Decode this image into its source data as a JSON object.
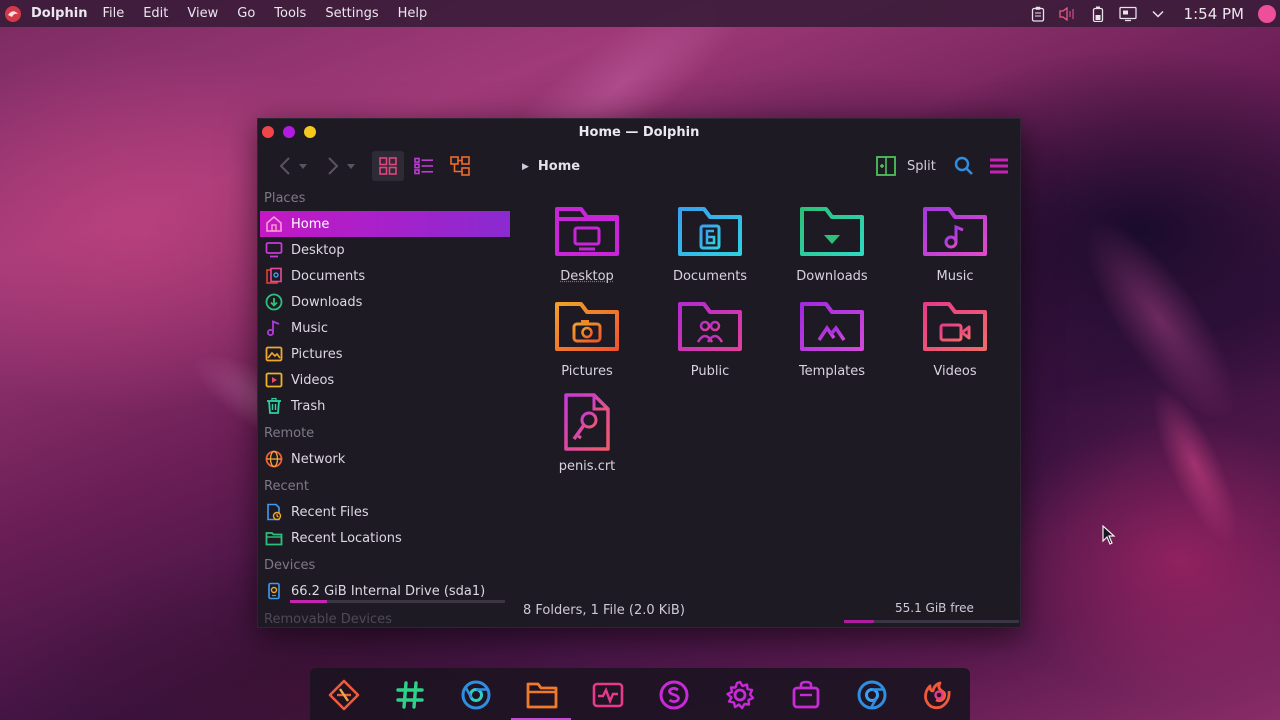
{
  "topbar": {
    "app_name": "Dolphin",
    "menus": [
      "File",
      "Edit",
      "View",
      "Go",
      "Tools",
      "Settings",
      "Help"
    ],
    "clock": "1:54 PM",
    "tray_icons": [
      "clipboard-icon",
      "volume-muted-icon",
      "battery-icon",
      "network-icon",
      "chevron-down-icon"
    ]
  },
  "window": {
    "title": "Home — Dolphin",
    "breadcrumb": "Home",
    "split_label": "Split",
    "sidebar": {
      "places_title": "Places",
      "places": [
        {
          "label": "Home",
          "icon": "home-icon",
          "active": true
        },
        {
          "label": "Desktop",
          "icon": "desktop-icon"
        },
        {
          "label": "Documents",
          "icon": "documents-icon"
        },
        {
          "label": "Downloads",
          "icon": "downloads-icon"
        },
        {
          "label": "Music",
          "icon": "music-icon"
        },
        {
          "label": "Pictures",
          "icon": "pictures-icon"
        },
        {
          "label": "Videos",
          "icon": "videos-icon"
        },
        {
          "label": "Trash",
          "icon": "trash-icon"
        }
      ],
      "remote_title": "Remote",
      "remote": [
        {
          "label": "Network",
          "icon": "network-globe-icon"
        }
      ],
      "recent_title": "Recent",
      "recent": [
        {
          "label": "Recent Files",
          "icon": "recent-files-icon"
        },
        {
          "label": "Recent Locations",
          "icon": "recent-locations-icon"
        }
      ],
      "devices_title": "Devices",
      "devices": [
        {
          "label": "66.2 GiB Internal Drive (sda1)",
          "icon": "drive-icon",
          "usage_fraction": 0.17
        }
      ],
      "removable_title": "Removable Devices"
    },
    "files": [
      {
        "label": "Desktop",
        "icon": "folder-desktop-icon",
        "selected": true
      },
      {
        "label": "Documents",
        "icon": "folder-documents-icon"
      },
      {
        "label": "Downloads",
        "icon": "folder-downloads-icon"
      },
      {
        "label": "Music",
        "icon": "folder-music-icon"
      },
      {
        "label": "Pictures",
        "icon": "folder-pictures-icon"
      },
      {
        "label": "Public",
        "icon": "folder-public-icon"
      },
      {
        "label": "Templates",
        "icon": "folder-templates-icon"
      },
      {
        "label": "Videos",
        "icon": "folder-videos-icon"
      },
      {
        "label": "penis.crt",
        "icon": "certificate-file-icon"
      }
    ],
    "status_text": "8 Folders, 1 File (2.0 KiB)",
    "free_space": "55.1 GiB free",
    "free_fraction": 0.17
  },
  "dock": {
    "apps": [
      "git-icon",
      "slack-icon",
      "chrome-icon",
      "files-icon",
      "system-monitor-icon",
      "skype-icon",
      "settings-icon",
      "store-icon",
      "chromium-icon",
      "firefox-icon"
    ],
    "active": "files-icon"
  },
  "colors": {
    "accent_magenta": "#c418c4",
    "accent_violet": "#8a2ad0",
    "window_bg": "#1e1a24",
    "topbar_bg": "#3c1c3a"
  }
}
